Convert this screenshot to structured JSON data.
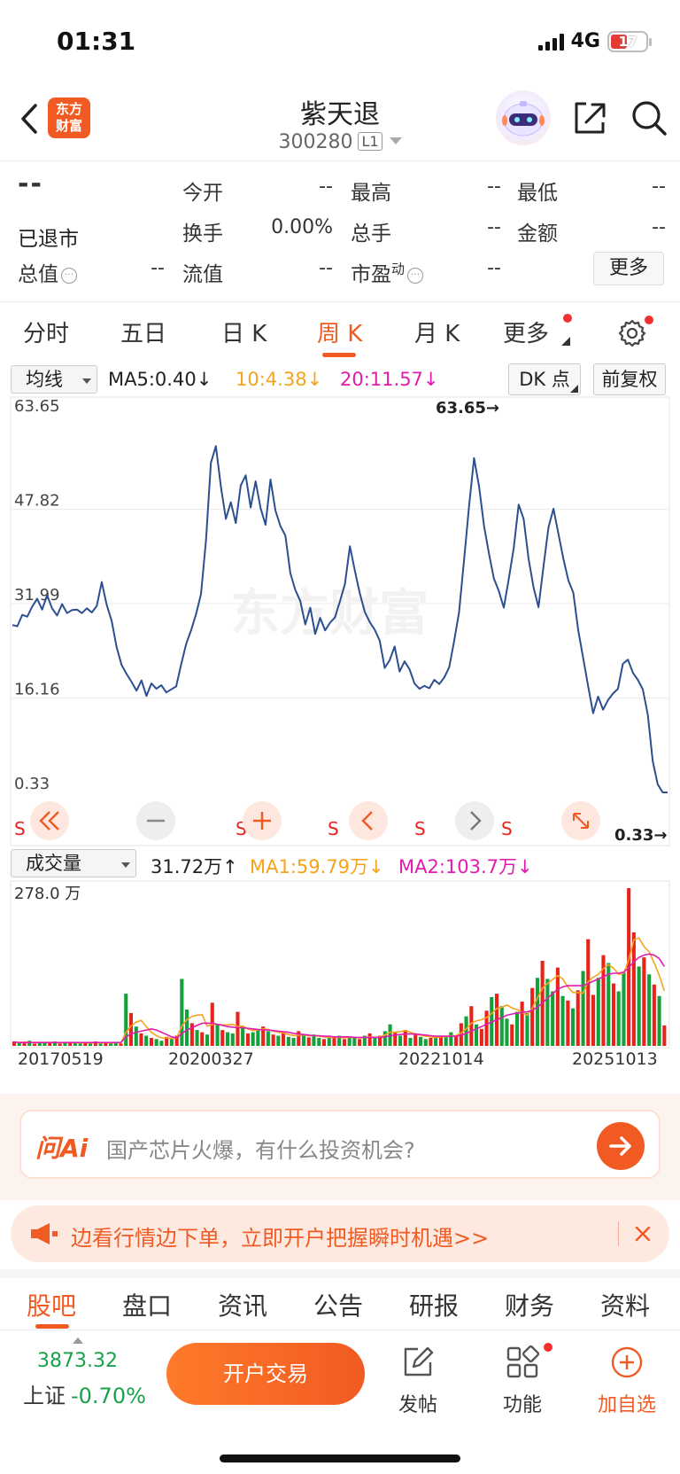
{
  "status": {
    "time": "01:31",
    "network": "4G",
    "battery": "17"
  },
  "header": {
    "logo": [
      "东方",
      "财富"
    ],
    "title": "紫天退",
    "code": "300280",
    "level": "L1"
  },
  "quote": {
    "price": "--",
    "state": "已退市",
    "fields": {
      "open_label": "今开",
      "open": "--",
      "high_label": "最高",
      "high": "--",
      "low_label": "最低",
      "low": "--",
      "turnover_label": "换手",
      "turnover": "0.00%",
      "volume_label": "总手",
      "volume": "--",
      "amount_label": "金额",
      "amount": "--",
      "mcap_label": "总值",
      "mcap": "--",
      "float_label": "流值",
      "float": "--",
      "pe_label": "市盈",
      "pe_sup": "动",
      "pe": "--"
    },
    "more_label": "更多"
  },
  "period_tabs": [
    "分时",
    "五日",
    "日 K",
    "周 K",
    "月 K",
    "更多"
  ],
  "period_active": "周 K",
  "ma_row": {
    "selector": "均线",
    "ma5": "MA5:0.40",
    "ma10": "10:4.38",
    "ma20": "20:11.57",
    "dk_label": "DK 点",
    "adj_label": "前复权"
  },
  "chart_data": [
    {
      "type": "line",
      "title": "",
      "y_ticks": [
        "63.65",
        "47.82",
        "31.99",
        "16.16",
        "0.33"
      ],
      "ylim": [
        0.33,
        63.65
      ],
      "max_marker": "63.65→",
      "min_marker": "0.33→",
      "series": [
        {
          "values": [
            28.4,
            28.2,
            30.1,
            29.8,
            31.5,
            32.8,
            31.0,
            33.4,
            31.2,
            30.0,
            31.9,
            30.4,
            30.9,
            31.0,
            30.4,
            31.2,
            30.5,
            31.6,
            35.6,
            31.8,
            29.1,
            24.7,
            21.7,
            20.2,
            18.9,
            17.4,
            19.1,
            16.5,
            18.6,
            17.7,
            18.3,
            17.1,
            17.6,
            18.1,
            21.8,
            25.2,
            27.5,
            30.2,
            33.6,
            42.5,
            55.6,
            58.4,
            51.6,
            46.2,
            49.0,
            45.5,
            51.8,
            53.5,
            48.1,
            52.5,
            48.0,
            45.2,
            52.8,
            47.6,
            45.0,
            43.4,
            37.1,
            34.3,
            32.4,
            28.5,
            31.3,
            26.9,
            29.6,
            27.5,
            28.8,
            29.7,
            32.4,
            35.3,
            41.6,
            37.5,
            33.7,
            30.6,
            28.9,
            27.6,
            25.8,
            21.2,
            22.5,
            24.8,
            20.6,
            22.3,
            21.0,
            18.6,
            17.7,
            18.2,
            17.8,
            19.2,
            18.5,
            19.6,
            21.3,
            25.7,
            30.6,
            39.4,
            48.4,
            56.4,
            51.7,
            45.1,
            40.4,
            36.2,
            34.1,
            31.3,
            36.1,
            41.3,
            48.6,
            46.2,
            39.5,
            34.7,
            31.4,
            38.2,
            44.8,
            47.9,
            43.7,
            39.5,
            35.9,
            33.8,
            27.5,
            22.8,
            18.1,
            13.6,
            16.4,
            14.2,
            15.8,
            16.9,
            17.7,
            21.9,
            22.6,
            20.4,
            19.2,
            17.6,
            13.4,
            5.6,
            1.7,
            0.33,
            0.33
          ]
        }
      ]
    },
    {
      "type": "bar",
      "title": "",
      "y_max_label": "278.0 万",
      "ylim": [
        0,
        278
      ],
      "x_labels": [
        "20170519",
        "20200327",
        "20221014",
        "20251013"
      ],
      "volume": [
        8,
        6,
        5,
        9,
        4,
        7,
        5,
        6,
        8,
        4,
        6,
        5,
        7,
        4,
        6,
        5,
        8,
        4,
        6,
        5,
        7,
        4,
        92,
        58,
        34,
        22,
        18,
        14,
        12,
        9,
        16,
        12,
        18,
        118,
        64,
        40,
        28,
        24,
        20,
        76,
        38,
        28,
        24,
        22,
        60,
        34,
        22,
        24,
        28,
        34,
        26,
        20,
        18,
        22,
        16,
        14,
        26,
        18,
        15,
        20,
        14,
        12,
        16,
        14,
        18,
        12,
        16,
        14,
        12,
        18,
        22,
        14,
        18,
        26,
        38,
        24,
        18,
        28,
        14,
        20,
        16,
        12,
        14,
        16,
        18,
        16,
        24,
        18,
        40,
        52,
        70,
        38,
        30,
        62,
        86,
        92,
        70,
        48,
        38,
        60,
        78,
        58,
        102,
        120,
        150,
        118,
        96,
        138,
        88,
        80,
        66,
        98,
        132,
        188,
        90,
        120,
        160,
        146,
        110,
        96,
        130,
        278,
        200,
        140,
        156,
        126,
        108,
        88,
        36
      ],
      "up_flags": [
        1,
        0,
        1,
        0,
        1,
        0,
        0,
        1,
        0,
        1,
        0,
        1,
        0,
        0,
        1,
        0,
        1,
        0,
        1,
        0,
        0,
        1,
        0,
        1,
        0,
        1,
        0,
        1,
        0,
        0,
        1,
        0,
        1,
        0,
        0,
        1,
        0,
        1,
        0,
        1,
        0,
        1,
        0,
        0,
        1,
        0,
        1,
        0,
        0,
        1,
        0,
        1,
        0,
        1,
        0,
        0,
        1,
        0,
        1,
        0,
        0,
        1,
        0,
        1,
        0,
        1,
        0,
        0,
        1,
        0,
        1,
        0,
        1,
        0,
        0,
        1,
        0,
        1,
        0,
        1,
        0,
        0,
        1,
        0,
        1,
        0,
        0,
        1,
        1,
        0,
        1,
        0,
        1,
        1,
        0,
        1,
        0,
        0,
        1,
        0,
        1,
        0,
        1,
        0,
        1,
        0,
        0,
        1,
        0,
        1,
        0,
        1,
        0,
        1,
        1,
        0,
        1,
        0,
        1,
        0,
        0,
        1,
        1,
        0,
        1,
        0,
        1,
        0,
        1
      ],
      "series": [
        {
          "name": "MA1",
          "values": [
            7,
            6,
            7,
            6,
            6,
            6,
            6,
            6,
            6,
            5,
            6,
            6,
            6,
            5,
            6,
            5,
            6,
            5,
            6,
            5,
            6,
            5,
            24,
            35,
            42,
            45,
            34,
            24,
            18,
            14,
            14,
            13,
            14,
            35,
            46,
            52,
            54,
            55,
            35,
            38,
            38,
            37,
            37,
            38,
            34,
            35,
            30,
            27,
            28,
            30,
            29,
            26,
            24,
            23,
            20,
            18,
            19,
            19,
            18,
            18,
            17,
            16,
            15,
            15,
            15,
            14,
            15,
            15,
            14,
            15,
            16,
            15,
            16,
            19,
            24,
            24,
            25,
            27,
            24,
            21,
            19,
            17,
            16,
            15,
            16,
            16,
            18,
            18,
            23,
            30,
            40,
            44,
            46,
            50,
            57,
            66,
            68,
            72,
            67,
            64,
            59,
            54,
            67,
            84,
            102,
            110,
            117,
            124,
            118,
            104,
            94,
            94,
            93,
            113,
            121,
            126,
            136,
            143,
            137,
            126,
            128,
            152,
            187,
            190,
            175,
            166,
            146,
            124,
            97
          ]
        },
        {
          "name": "MA2",
          "values": [
            7,
            6,
            6,
            6,
            6,
            6,
            6,
            6,
            6,
            6,
            6,
            6,
            6,
            6,
            6,
            6,
            6,
            6,
            6,
            6,
            6,
            6,
            16,
            21,
            24,
            26,
            28,
            30,
            28,
            24,
            20,
            16,
            14,
            22,
            28,
            32,
            36,
            40,
            40,
            40,
            38,
            36,
            34,
            33,
            32,
            32,
            31,
            30,
            29,
            28,
            28,
            27,
            26,
            25,
            24,
            22,
            21,
            20,
            19,
            18,
            18,
            17,
            17,
            16,
            16,
            16,
            16,
            15,
            15,
            15,
            15,
            15,
            15,
            16,
            18,
            19,
            20,
            21,
            21,
            21,
            20,
            19,
            18,
            17,
            17,
            17,
            17,
            17,
            19,
            22,
            26,
            30,
            34,
            38,
            42,
            46,
            50,
            54,
            56,
            58,
            59,
            60,
            63,
            68,
            76,
            84,
            92,
            100,
            104,
            106,
            106,
            106,
            106,
            110,
            114,
            118,
            122,
            126,
            128,
            128,
            130,
            138,
            148,
            156,
            160,
            162,
            160,
            154,
            140
          ]
        }
      ]
    }
  ],
  "volume_row": {
    "selector": "成交量",
    "vol": "31.72万",
    "ma1": "MA1:59.79万",
    "ma2": "MA2:103.7万"
  },
  "ai": {
    "logo": "问Ai",
    "placeholder": "国产芯片火爆，有什么投资机会?"
  },
  "promo": {
    "text": "边看行情边下单，立即开户把握瞬时机遇>>"
  },
  "bottom_tabs": [
    "股吧",
    "盘口",
    "资讯",
    "公告",
    "研报",
    "财务",
    "资料"
  ],
  "bottom_active": "股吧",
  "toolbar": {
    "index_value": "3873.32",
    "index_name": "上证",
    "index_change": "-0.70%",
    "trade_label": "开户交易",
    "post_label": "发帖",
    "func_label": "功能",
    "fav_label": "加自选"
  },
  "colors": {
    "brand": "#f15a22",
    "price_line": "#2b4f8f",
    "up": "#e8231c",
    "down": "#14a13a",
    "ma10": "#f5a31a",
    "ma20": "#e21bb0"
  }
}
